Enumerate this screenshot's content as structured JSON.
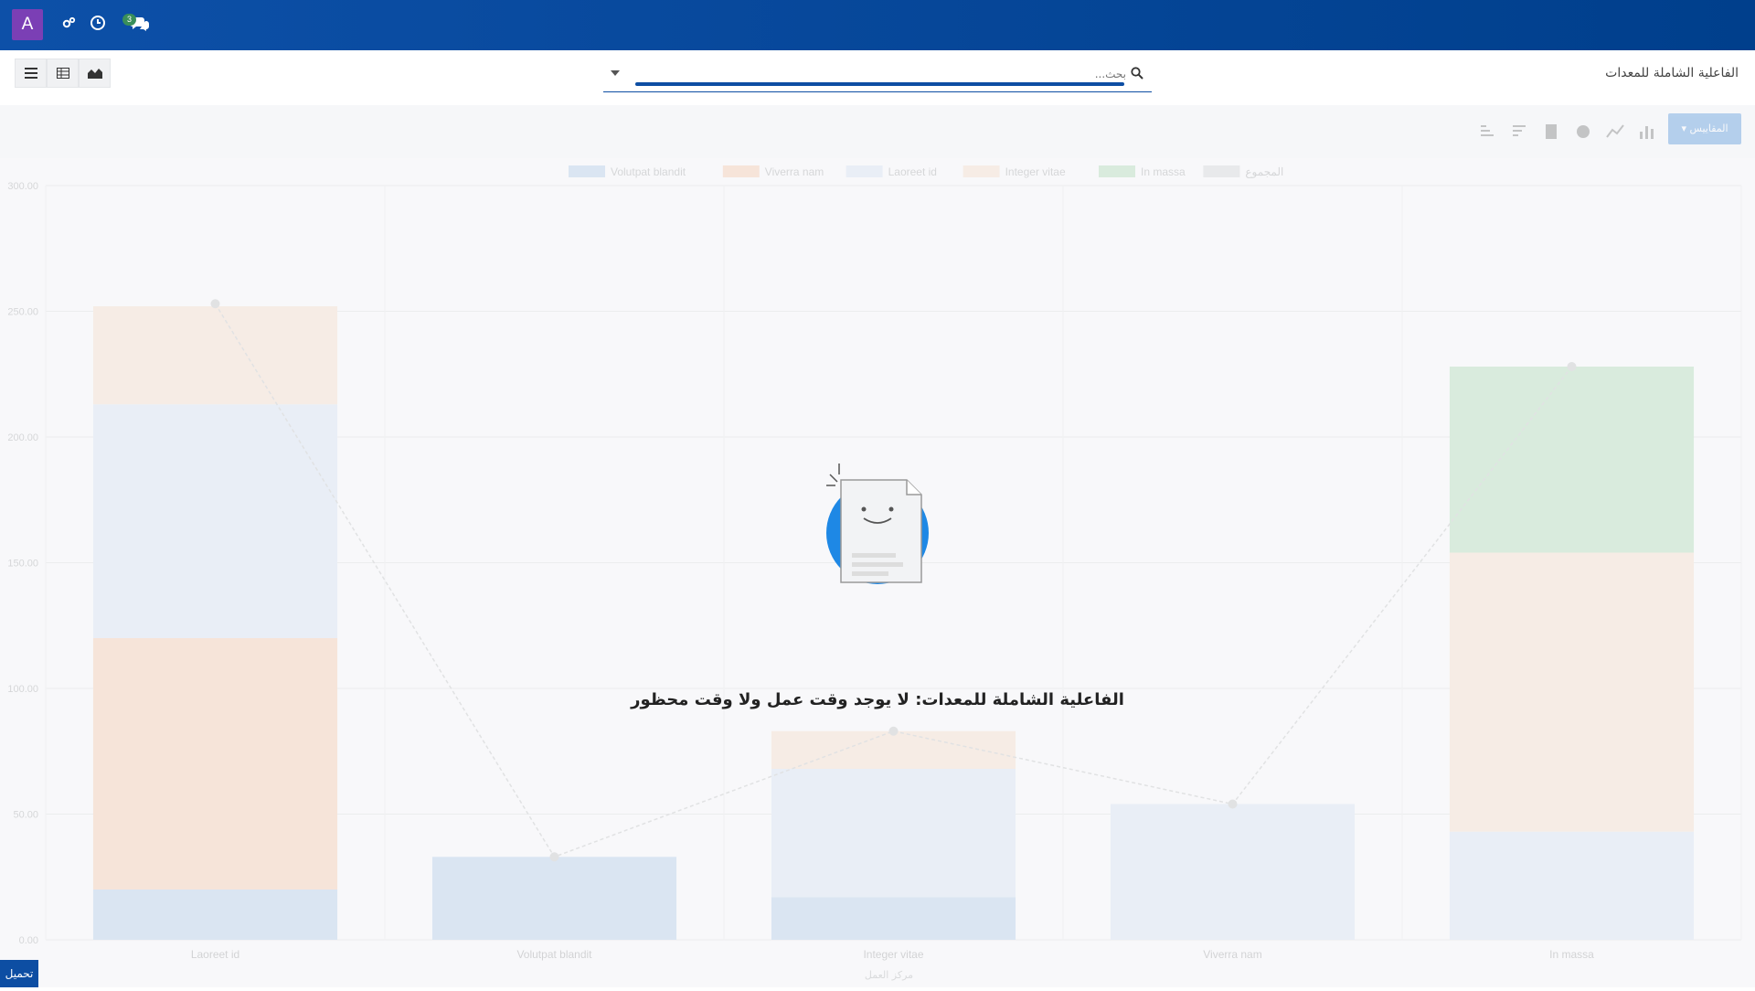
{
  "topbar": {
    "avatar_letter": "A",
    "badge_count": "3",
    "icons": [
      "settings-icon",
      "clock-icon",
      "chat-icon"
    ]
  },
  "controls": {
    "search_placeholder": "بحث...",
    "title": "الفاعلية الشاملة للمعدات",
    "views": [
      "list-icon",
      "pivot-icon",
      "graph-icon"
    ]
  },
  "toolbar": {
    "measures_label": "المقاييس",
    "icons": [
      "bar-chart-icon",
      "line-chart-icon",
      "pie-chart-icon",
      "database-icon",
      "sort-desc-icon",
      "sort-asc-icon"
    ]
  },
  "chart_data": {
    "type": "bar",
    "categories": [
      "Laoreet id",
      "Volutpat blandit",
      "Integer vitae",
      "Viverra nam",
      "In massa"
    ],
    "series": [
      {
        "name": "Volutpat blandit",
        "values": [
          20,
          33,
          17,
          0,
          0
        ],
        "color": "#7aa7dc"
      },
      {
        "name": "Viverra nam",
        "values": [
          100,
          0,
          0,
          0,
          0
        ],
        "color": "#f7a36b"
      },
      {
        "name": "Laoreet id",
        "values": [
          93,
          0,
          51,
          54,
          43
        ],
        "color": "#bcd3ef"
      },
      {
        "name": "Integer vitae",
        "values": [
          39,
          0,
          15,
          0,
          111
        ],
        "color": "#f9c8a3"
      },
      {
        "name": "In massa",
        "values": [
          0,
          0,
          0,
          0,
          74
        ],
        "color": "#78c47d"
      }
    ],
    "line_label": "المجموع",
    "line_values": [
      253,
      33,
      83,
      54,
      228
    ],
    "y_ticks": [
      "0.00",
      "50.00",
      "100.00",
      "150.00",
      "200.00",
      "250.00",
      "300.00"
    ],
    "ylim": [
      0,
      300
    ],
    "xlabel": "مركز العمل",
    "legend_position": "top"
  },
  "empty_state": {
    "message": "الفاعلية الشاملة للمعدات: لا يوجد وقت عمل ولا وقت محظور"
  },
  "footer": {
    "download_label": "تحميل"
  }
}
